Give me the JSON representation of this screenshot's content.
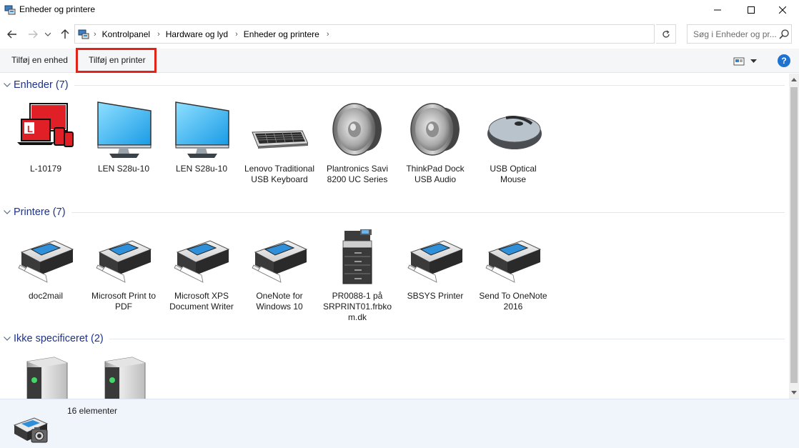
{
  "window": {
    "title": "Enheder og printere"
  },
  "address": {
    "crumbs": [
      "Kontrolpanel",
      "Hardware og lyd",
      "Enheder og printere"
    ],
    "search_placeholder": "Søg i Enheder og pr..."
  },
  "toolbar": {
    "add_device": "Tilføj en enhed",
    "add_printer": "Tilføj en printer",
    "help": "?"
  },
  "groups": {
    "devices": {
      "title": "Enheder (7)",
      "items": [
        {
          "label": "L-10179",
          "icon": "laptop-devices-icon"
        },
        {
          "label": "LEN S28u-10",
          "icon": "monitor-icon"
        },
        {
          "label": "LEN S28u-10",
          "icon": "monitor-icon"
        },
        {
          "label": "Lenovo Traditional USB Keyboard",
          "icon": "keyboard-icon"
        },
        {
          "label": "Plantronics Savi 8200 UC Series",
          "icon": "speaker-icon"
        },
        {
          "label": "ThinkPad Dock USB Audio",
          "icon": "speaker-icon"
        },
        {
          "label": "USB Optical Mouse",
          "icon": "mouse-icon"
        }
      ]
    },
    "printers": {
      "title": "Printere (7)",
      "items": [
        {
          "label": "doc2mail",
          "icon": "printer-icon"
        },
        {
          "label": "Microsoft Print to PDF",
          "icon": "printer-icon"
        },
        {
          "label": "Microsoft XPS Document Writer",
          "icon": "printer-icon"
        },
        {
          "label": "OneNote for Windows 10",
          "icon": "printer-icon"
        },
        {
          "label": "PR0088-1 på SRPRINT01.frbkom.dk",
          "icon": "copier-icon"
        },
        {
          "label": "SBSYS Printer",
          "icon": "printer-icon"
        },
        {
          "label": "Send To OneNote 2016",
          "icon": "printer-icon"
        }
      ]
    },
    "unspecified": {
      "title": "Ikke specificeret (2)",
      "items": [
        {
          "label": "",
          "icon": "server-icon"
        },
        {
          "label": "",
          "icon": "server-icon"
        }
      ]
    }
  },
  "status": {
    "count_text": "16 elementer"
  },
  "colors": {
    "accent": "#1e3287",
    "highlight": "#e2231a",
    "help": "#1e73d2"
  }
}
